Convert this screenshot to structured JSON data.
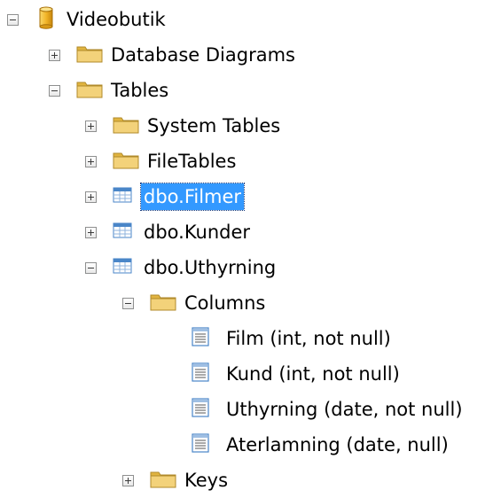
{
  "tree": {
    "root": {
      "label": "Videobutik",
      "icon": "database-icon",
      "expanded": true
    },
    "database_diagrams": {
      "label": "Database Diagrams",
      "icon": "folder-icon",
      "expanded": false
    },
    "tables": {
      "label": "Tables",
      "icon": "folder-icon",
      "expanded": true
    },
    "system_tables": {
      "label": "System Tables",
      "icon": "folder-icon",
      "expanded": false
    },
    "file_tables": {
      "label": "FileTables",
      "icon": "folder-icon",
      "expanded": false
    },
    "filmer": {
      "label": "dbo.Filmer",
      "icon": "table-icon",
      "expanded": false,
      "selected": true
    },
    "kunder": {
      "label": "dbo.Kunder",
      "icon": "table-icon",
      "expanded": false
    },
    "uthyrning": {
      "label": "dbo.Uthyrning",
      "icon": "table-icon",
      "expanded": true
    },
    "columns": {
      "label": "Columns",
      "icon": "folder-icon",
      "expanded": true
    },
    "column_items": [
      {
        "label": "Film (int, not null)",
        "icon": "column-icon"
      },
      {
        "label": "Kund (int, not null)",
        "icon": "column-icon"
      },
      {
        "label": "Uthyrning (date, not null)",
        "icon": "column-icon"
      },
      {
        "label": "Aterlamning (date, null)",
        "icon": "column-icon"
      }
    ],
    "keys": {
      "label": "Keys",
      "icon": "folder-icon",
      "expanded": false
    }
  },
  "colors": {
    "selection": "#3399ff",
    "folder": "#e9c45a",
    "database": "#f2b529",
    "table": "#4a86c8"
  }
}
